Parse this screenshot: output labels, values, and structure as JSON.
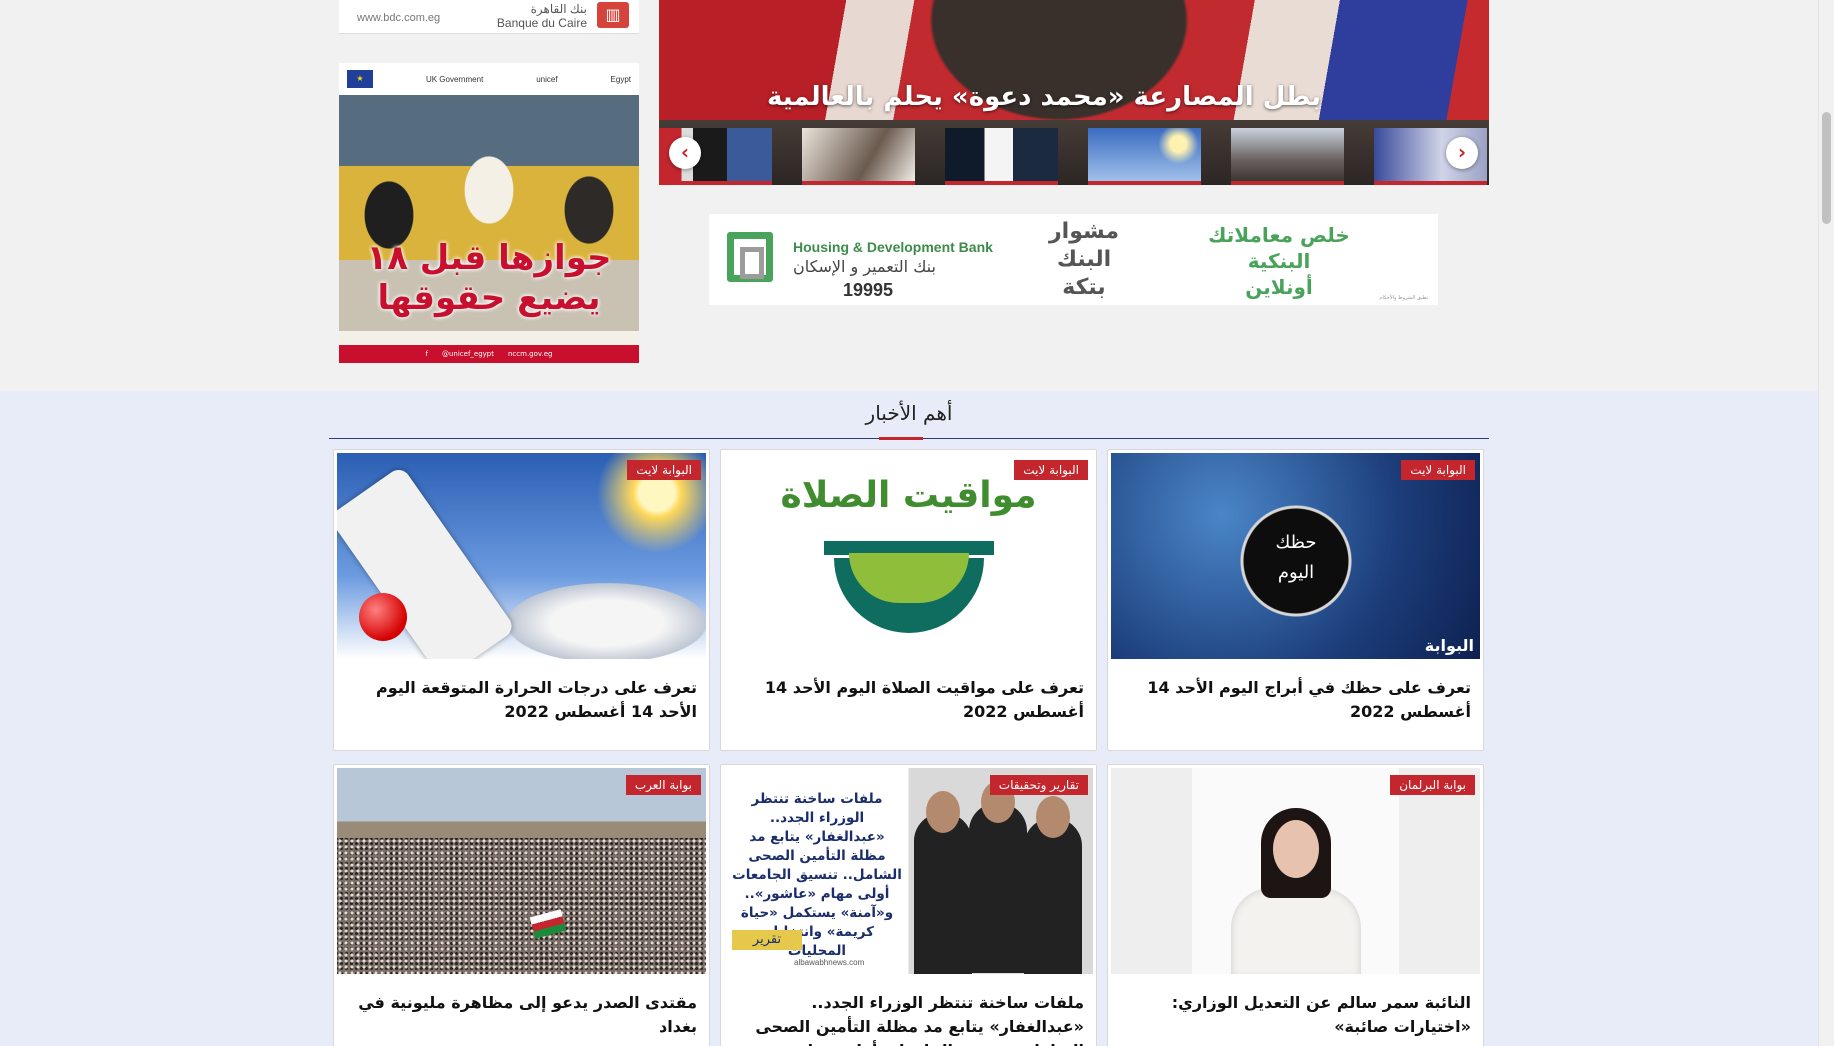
{
  "ads": {
    "bank_cairo": {
      "url": "www.bdc.com.eg",
      "name_ar": "بنك القاهرة",
      "name_en": "Banque du Caire"
    },
    "unicef": {
      "logos": [
        "UK Government",
        "unicef",
        "Egypt"
      ],
      "slogan_line1": "جوازها قبل ١٨",
      "slogan_line2": "يضيع حقوقها",
      "footer": [
        "f",
        "@unicef_egypt",
        "nccm.gov.eg"
      ]
    },
    "housing_bank": {
      "name_en": "Housing & Development Bank",
      "name_ar": "بنك التعمير و الإسكان",
      "hotline": "19995",
      "mid_text": [
        "مشوار",
        "البنك",
        "بتكة"
      ],
      "right_text": [
        "خلص معاملاتك",
        "البنكية",
        "أونلاين"
      ],
      "terms": "تطبق الشروط والأحكام"
    }
  },
  "slider": {
    "headline": "بطل المصارعة «محمد دعوة» يحلم بالعالمية",
    "prev_icon": "chevron-left-icon",
    "next_icon": "chevron-right-icon",
    "accent": "#c4262e"
  },
  "news": {
    "section_title": "أهم الأخبار",
    "cards": [
      {
        "badge": "البوابة لايت",
        "title": "تعرف على حظك في أبراج اليوم الأحد 14 أغسطس 2022",
        "image": "horoscope",
        "image_text": "حظك اليوم",
        "image_brand": "البوابة"
      },
      {
        "badge": "البوابة لايت",
        "title": "تعرف على مواقيت الصلاة اليوم الأحد 14 أغسطس 2022",
        "image": "prayer-times",
        "image_text": "مواقيت الصلاة"
      },
      {
        "badge": "البوابة لايت",
        "title": "تعرف على درجات الحرارة المتوقعة اليوم الأحد 14 أغسطس 2022",
        "image": "thermometer"
      },
      {
        "badge": "بوابة البرلمان",
        "title": "النائبة سمر سالم عن التعديل الوزاري: «اختيارات صائبة»",
        "image": "portrait"
      },
      {
        "badge": "تقارير وتحقيقات",
        "title": "ملفات ساخنة تنتظر الوزراء الجدد.. «عبدالغفار» يتابع مد مظلة التأمين الصحى الشامل.. تنسيق الجامعات أولى مهام «عاشور».. و«آمنة» يستكمل",
        "image": "report",
        "image_text": "ملفات ساخنة تنتظر الوزراء الجدد.. «عبدالغفار» يتابع مد مظلة التأمين الصحى الشامل.. تنسيق الجامعات أولى مهام «عاشور».. و«آمنة» يستكمل «حياة كريمة» وانتخابات المحليات",
        "image_tag": "تقرير",
        "image_site": "albawabhnews.com"
      },
      {
        "badge": "بوابة العرب",
        "title": "مقتدى الصدر يدعو إلى مظاهرة مليونية في بغداد",
        "image": "crowd"
      }
    ]
  }
}
